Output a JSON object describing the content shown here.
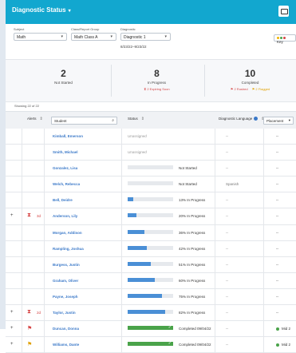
{
  "header": {
    "title": "Diagnostic Status",
    "caret": "▾",
    "print_icon": "print-icon"
  },
  "filters": {
    "subject": {
      "label": "Subject",
      "value": "Math"
    },
    "class_group": {
      "label": "Class/Report Group",
      "value": "Math Class A"
    },
    "diagnostic": {
      "label": "Diagnostic",
      "value": "Diagnostic 1",
      "date_range": "8/23/22–9/23/22"
    },
    "key_label": "Key",
    "key_colors": [
      "#f0b400",
      "#4aa34a",
      "#d64545"
    ]
  },
  "summary": {
    "not_started": {
      "count": "2",
      "label": "Not Started"
    },
    "in_progress": {
      "count": "8",
      "label": "In Progress",
      "sub": "2 Expiring Soon"
    },
    "completed": {
      "count": "10",
      "label": "Completed",
      "sub1": "2 Rushed",
      "sub2": "2 Flagged"
    }
  },
  "showing": "Showing 22 of 22",
  "table": {
    "headers": {
      "alerts": "Alerts",
      "student": "Student",
      "status": "Status",
      "language": "Diagnostic Language",
      "placement": "Placement"
    },
    "rows": [
      {
        "plus": "",
        "alert": "",
        "alert_text": "",
        "name": "Kimball, Emerson",
        "status_type": "unassigned",
        "progress": 0,
        "status": "Unassigned",
        "language": "--",
        "placement": "--"
      },
      {
        "plus": "",
        "alert": "",
        "alert_text": "",
        "name": "Smith, Michael",
        "status_type": "unassigned",
        "progress": 0,
        "status": "Unassigned",
        "language": "--",
        "placement": "--"
      },
      {
        "plus": "",
        "alert": "",
        "alert_text": "",
        "name": "Gonzalez, Lisa",
        "status_type": "bar",
        "progress": 0,
        "status": "Not Started",
        "language": "--",
        "placement": "--"
      },
      {
        "plus": "",
        "alert": "",
        "alert_text": "",
        "name": "Welch, Rebecca",
        "status_type": "bar",
        "progress": 0,
        "status": "Not Started",
        "language": "Spanish",
        "placement": "--"
      },
      {
        "plus": "",
        "alert": "",
        "alert_text": "",
        "name": "Bell, Deidre",
        "status_type": "bar",
        "progress": 13,
        "status": "13% In Progress",
        "language": "--",
        "placement": "--"
      },
      {
        "plus": "+",
        "alert": "⧗",
        "alert_text": "3d",
        "name": "Anderson, Lily",
        "status_type": "bar",
        "progress": 20,
        "status": "20% In Progress",
        "language": "--",
        "placement": "--"
      },
      {
        "plus": "",
        "alert": "",
        "alert_text": "",
        "name": "Morgan, Addison",
        "status_type": "bar",
        "progress": 36,
        "status": "36% In Progress",
        "language": "--",
        "placement": "--"
      },
      {
        "plus": "",
        "alert": "",
        "alert_text": "",
        "name": "Rampling, Joshua",
        "status_type": "bar",
        "progress": 42,
        "status": "42% In Progress",
        "language": "--",
        "placement": "--"
      },
      {
        "plus": "",
        "alert": "",
        "alert_text": "",
        "name": "Burgess, Justin",
        "status_type": "bar",
        "progress": 51,
        "status": "51% In Progress",
        "language": "--",
        "placement": "--"
      },
      {
        "plus": "",
        "alert": "",
        "alert_text": "",
        "name": "Graham, Oliver",
        "status_type": "bar",
        "progress": 60,
        "status": "60% In Progress",
        "language": "--",
        "placement": "--"
      },
      {
        "plus": "",
        "alert": "",
        "alert_text": "",
        "name": "Payne, Joseph",
        "status_type": "bar",
        "progress": 75,
        "status": "75% In Progress",
        "language": "--",
        "placement": "--"
      },
      {
        "plus": "+",
        "alert": "⧗",
        "alert_text": "2d",
        "name": "Taylor, Justin",
        "status_type": "bar",
        "progress": 82,
        "status": "82% In Progress",
        "language": "--",
        "placement": "--"
      },
      {
        "plus": "+",
        "alert": "⚑",
        "alert_text": "",
        "name": "Duncan, Donna",
        "status_type": "complete",
        "progress": 100,
        "status": "Completed 09/04/22",
        "language": "--",
        "placement": "Mid 2"
      },
      {
        "plus": "+",
        "alert": "⚑",
        "alert_text": "",
        "name": "Williams, Dante",
        "status_type": "complete",
        "progress": 100,
        "status": "Completed 09/04/22",
        "language": "--",
        "placement": "Mid 2"
      }
    ]
  }
}
